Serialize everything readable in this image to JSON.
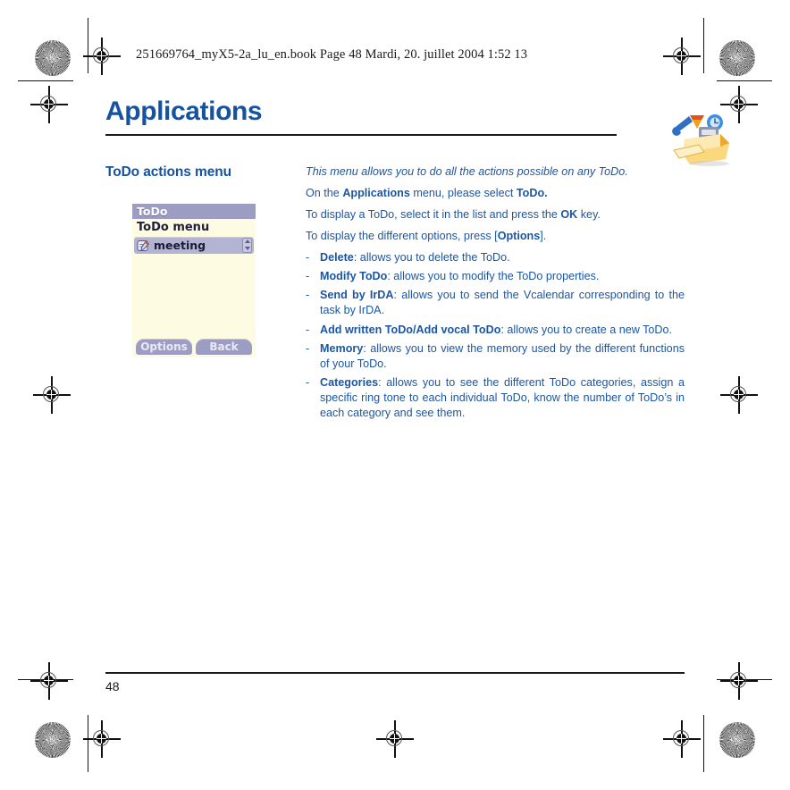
{
  "scan": {
    "header_line": "251669764_myX5-2a_lu_en.book  Page 48  Mardi, 20. juillet 2004  1:52 13"
  },
  "header": {
    "title": "Applications",
    "icon": "applications-toolbox-icon"
  },
  "section": {
    "heading": "ToDo actions menu"
  },
  "phone_screenshot": {
    "titlebar": "ToDo",
    "subtitle": "ToDo menu",
    "selected_item": "meeting",
    "item_icon": "todo-note-icon",
    "scroll_icon": "scroll-up-down-icon",
    "softkey_left": "Options",
    "softkey_right": "Back"
  },
  "body": {
    "lead": "This menu allows you to do all the actions possible on any ToDo.",
    "p1_pre": "On the ",
    "p1_bold1": "Applications",
    "p1_mid": " menu, please select ",
    "p1_bold2": "ToDo.",
    "p2_pre": "To display a ToDo, select it in the list and press the ",
    "p2_bold": "OK",
    "p2_post": " key.",
    "p3_pre": "To display the different options, press [",
    "p3_bold": "Options",
    "p3_post": "]."
  },
  "options": {
    "dash": "-",
    "items": [
      {
        "term": "Delete",
        "desc": ": allows you to delete the ToDo."
      },
      {
        "term": "Modify ToDo",
        "desc": ": allows you to modify the ToDo properties."
      },
      {
        "term": "Send by IrDA",
        "desc": ": allows you to send the Vcalendar corresponding to the task by IrDA."
      },
      {
        "term": "Add written ToDo/Add vocal ToDo",
        "desc": ": allows you to create a new ToDo."
      },
      {
        "term": "Memory",
        "desc": ": allows you to view the memory used by the different functions of your ToDo."
      },
      {
        "term": "Categories",
        "desc": ": allows you to see the different ToDo categories, assign a specific ring tone to each individual ToDo, know the number of ToDo’s in each category and see them."
      }
    ]
  },
  "footer": {
    "page_number": "48"
  },
  "colors": {
    "title_blue": "#15529f",
    "body_blue": "#1b56a4",
    "rule_black": "#1a1a1a",
    "phone_titlebar": "#9d9dc4",
    "phone_screen_bg": "#fdfbe2",
    "phone_row": "#b3b3d4"
  }
}
